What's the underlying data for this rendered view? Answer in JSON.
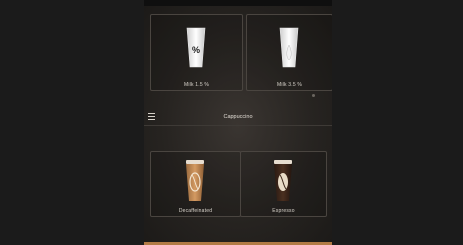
{
  "top_row": [
    {
      "label": "Milk 1.5 %",
      "icon": "milk-glass-percent-icon"
    },
    {
      "label": "Milk 3.5 %",
      "icon": "milk-glass-icon"
    }
  ],
  "header": {
    "title": "Cappuccino",
    "menu_icon": "hamburger-menu-icon"
  },
  "bottom_row": [
    {
      "label": "Decaffeinated",
      "icon": "decaf-cup-icon"
    },
    {
      "label": "Espresso",
      "icon": "espresso-cup-icon"
    }
  ],
  "colors": {
    "accent": "#b27b45",
    "background": "#272421"
  }
}
